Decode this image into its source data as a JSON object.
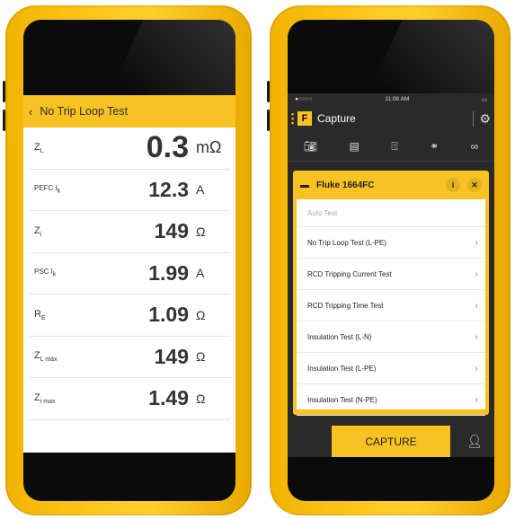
{
  "left": {
    "title": "No Trip Loop Test",
    "back": "‹",
    "rows": [
      {
        "label": "Z",
        "sub": "L",
        "value": "0.3",
        "unit": "mΩ",
        "big": true
      },
      {
        "label": "PEFC I",
        "sub": "k",
        "value": "12.3",
        "unit": "A"
      },
      {
        "label": "Z",
        "sub": "i",
        "value": "149",
        "unit": "Ω"
      },
      {
        "label": "PSC I",
        "sub": "k",
        "value": "1.99",
        "unit": "A"
      },
      {
        "label": "R",
        "sub": "E",
        "value": "1.09",
        "unit": "Ω"
      },
      {
        "label": "Z",
        "sub": "L max",
        "value": "149",
        "unit": "Ω"
      },
      {
        "label": "Z",
        "sub": "i max",
        "value": "1.49",
        "unit": "Ω"
      }
    ]
  },
  "right": {
    "status": {
      "carrier": "●○○○○",
      "time": "11:08 AM",
      "battery": "▭"
    },
    "app_title": "Capture",
    "logo": "F",
    "device": "Fluke 1664FC",
    "tests": [
      "Auto Test",
      "No Trip Loop Test (L-PE)",
      "RCD Tripping Current Test",
      "RCD Tripping Time Test",
      "Insulation Test (L-N)",
      "Insulation Test (L-PE)",
      "Insulation Test (N-PE)"
    ],
    "capture_label": "CAPTURE",
    "icons": [
      "camera-icon",
      "add-doc-icon",
      "wireless-icon",
      "link-icon",
      "chain-icon",
      "gear-icon",
      "info-icon",
      "close-icon",
      "person-icon"
    ]
  }
}
